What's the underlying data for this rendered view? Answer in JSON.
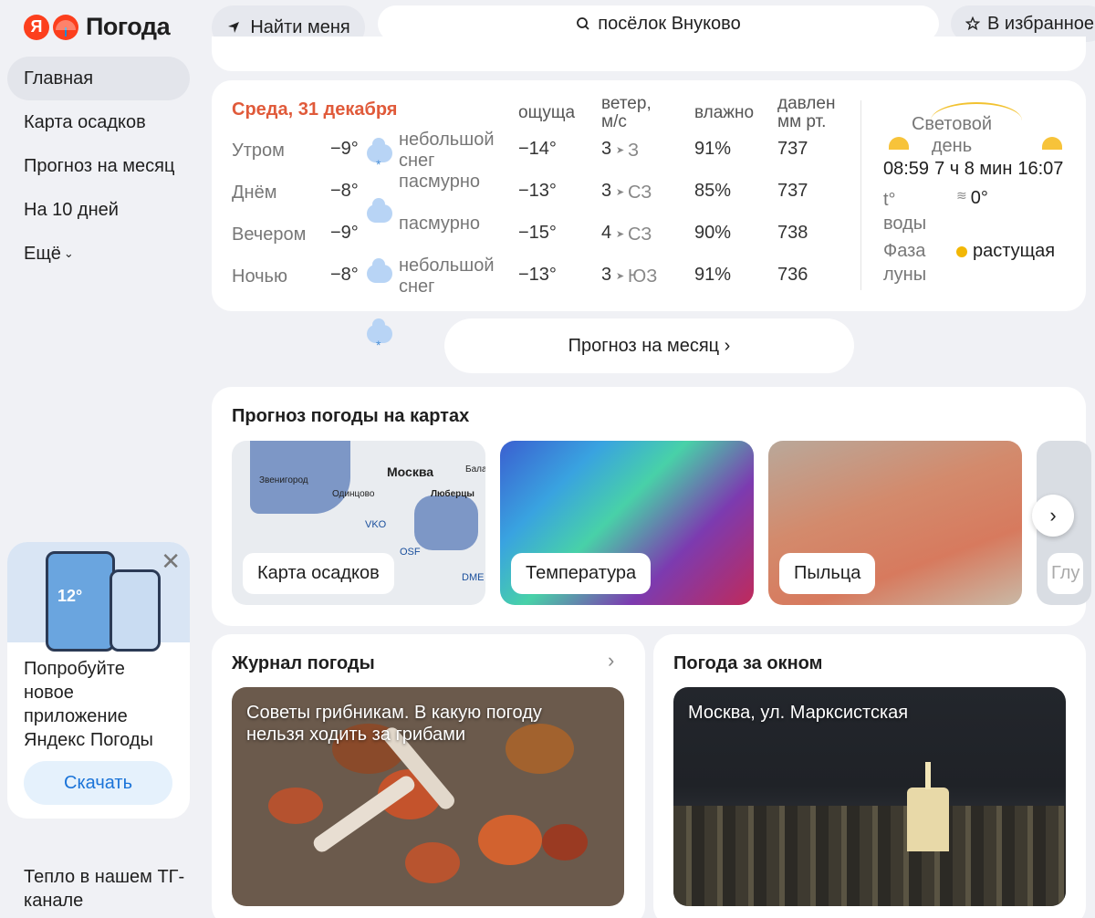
{
  "header": {
    "logo_letter": "Я",
    "logo_text": "Погода",
    "find_me": "Найти меня",
    "search_value": "посёлок Внуково",
    "favorites": "В избранное"
  },
  "sidebar": {
    "items": [
      {
        "label": "Главная"
      },
      {
        "label": "Карта осадков"
      },
      {
        "label": "Прогноз на месяц"
      },
      {
        "label": "На 10 дней"
      },
      {
        "label": "Ещё"
      }
    ]
  },
  "promo": {
    "phone_temp": "12°",
    "text": "Попробуйте новое приложение Яндекс Погоды",
    "button": "Скачать"
  },
  "tg_text": "Тепло в нашем ТГ-канале",
  "day": {
    "title": "Среда, 31 декабря",
    "columns": {
      "feels": "ощуща",
      "wind": "ветер, м/с",
      "humidity": "влажно",
      "pressure": "давлен мм рт. ст."
    },
    "rows": [
      {
        "part": "Утром",
        "temp": "−9°",
        "icon": "snow-cloud-icon",
        "cond": "небольшой снег",
        "feels": "−14°",
        "wind": "3",
        "dir": "З",
        "hum": "91%",
        "press": "737"
      },
      {
        "part": "Днём",
        "temp": "−8°",
        "icon": "cloud-icon",
        "cond": "пасмурно",
        "feels": "−13°",
        "wind": "3",
        "dir": "СЗ",
        "hum": "85%",
        "press": "737"
      },
      {
        "part": "Вечером",
        "temp": "−9°",
        "icon": "cloud-icon",
        "cond": "пасмурно",
        "feels": "−15°",
        "wind": "4",
        "dir": "СЗ",
        "hum": "90%",
        "press": "738"
      },
      {
        "part": "Ночью",
        "temp": "−8°",
        "icon": "snow-cloud-icon",
        "cond": "небольшой снег",
        "feels": "−13°",
        "wind": "3",
        "dir": "ЮЗ",
        "hum": "91%",
        "press": "736"
      }
    ],
    "side": {
      "daylight_label": "Световой день",
      "sunrise": "08:59",
      "duration": "7 ч 8 мин",
      "sunset": "16:07",
      "water_label": "t° воды",
      "water_value": "0°",
      "moon_label": "Фаза луны",
      "moon_value": "растущая"
    }
  },
  "month_button": "Прогноз на месяц ›",
  "maps": {
    "title": "Прогноз погоды на картах",
    "tiles": [
      {
        "label": "Карта осадков",
        "city": "Москва",
        "places": [
          "Звенигород",
          "Одинцово",
          "VKO",
          "OSF",
          "Люберцы",
          "DME",
          "Бала"
        ]
      },
      {
        "label": "Температура"
      },
      {
        "label": "Пыльца"
      },
      {
        "label": "Глу"
      }
    ]
  },
  "journal": {
    "title": "Журнал погоды",
    "article": "Советы грибникам. В какую погоду нельзя ходить за грибами"
  },
  "window": {
    "title": "Погода за окном",
    "camera": "Москва, ул. Марксистская"
  }
}
